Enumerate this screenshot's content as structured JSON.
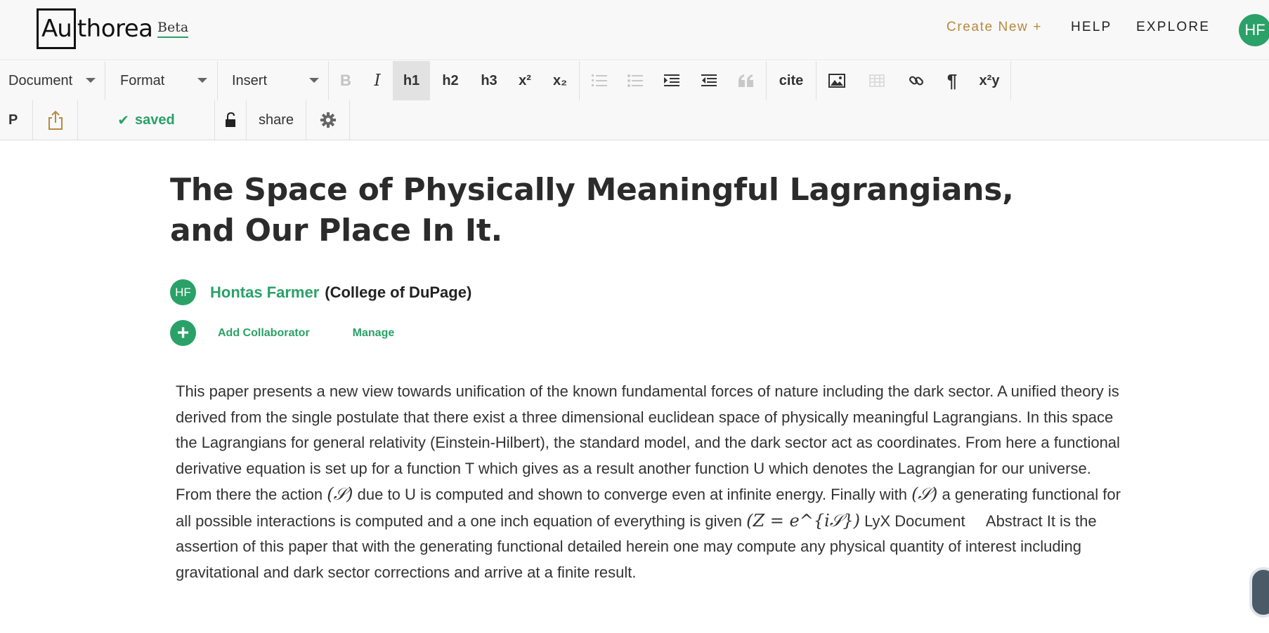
{
  "nav": {
    "logo_boxed": "Au",
    "logo_rest": "thorea",
    "beta": "Beta",
    "create_new": "Create New +",
    "help": "HELP",
    "explore": "EXPLORE",
    "user_initials": "HF"
  },
  "toolbar": {
    "document": "Document",
    "format": "Format",
    "insert": "Insert",
    "bold": "B",
    "italic": "I",
    "h1": "h1",
    "h2": "h2",
    "h3": "h3",
    "superscript": "x²",
    "subscript": "x₂",
    "cite": "cite",
    "pilcrow": "¶",
    "equation": "x²y",
    "paragraph_mode": "P",
    "saved": "saved",
    "share": "share"
  },
  "article": {
    "title": "The Space of Physically Meaningful Lagrangians, and Our Place In It.",
    "author_initials": "HF",
    "author_name": "Hontas Farmer",
    "affiliation": "(College of DuPage)",
    "add_collaborator": "Add Collaborator",
    "manage": "Manage",
    "abstract_1": "This paper presents a new view towards unification of the known fundamental forces of nature including the dark sector. A unified theory is derived from the single postulate that there exist a three dimensional euclidean space of physically meaningful Lagrangians. In this space the Lagrangians for general relativity (Einstein-Hilbert), the standard model, and the dark sector act as coordinates. From here a functional derivative equation is set up for a function T which gives as a result another function U which denotes the Lagrangian for our universe. From there the action",
    "math_action": "(𝒮)",
    "abstract_2": "due to U is computed and shown to converge even at infinite energy. Finally with",
    "math_s": "(𝒮)",
    "abstract_3": "a generating functional for all possible interactions is computed and a one inch equation of everything is given",
    "math_z": "(Z = e^{i𝒮})",
    "abstract_4": "LyX Document     Abstract It is the assertion of this paper that with the generating functional detailed herein one may compute any physical quantity of interest including gravitational and dark sector corrections and arrive at a finite result."
  }
}
